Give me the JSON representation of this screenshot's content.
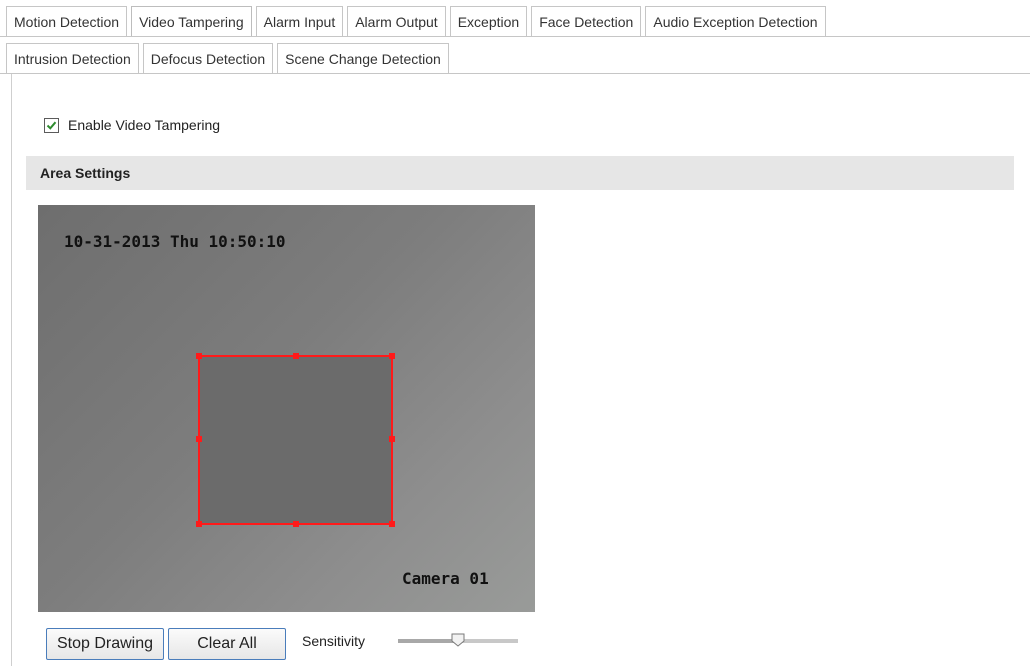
{
  "tabs": {
    "row1": [
      {
        "label": "Motion Detection",
        "active": false
      },
      {
        "label": "Video Tampering",
        "active": true
      },
      {
        "label": "Alarm Input",
        "active": false
      },
      {
        "label": "Alarm Output",
        "active": false
      },
      {
        "label": "Exception",
        "active": false
      },
      {
        "label": "Face Detection",
        "active": false
      },
      {
        "label": "Audio Exception Detection",
        "active": false
      }
    ],
    "row2": [
      {
        "label": "Intrusion Detection",
        "active": false
      },
      {
        "label": "Defocus Detection",
        "active": false
      },
      {
        "label": "Scene Change Detection",
        "active": false
      }
    ]
  },
  "enable": {
    "label": "Enable Video Tampering",
    "checked": true
  },
  "section": {
    "title": "Area Settings"
  },
  "video": {
    "timestamp": "10-31-2013 Thu 10:50:10",
    "camera_name": "Camera 01",
    "region_color": "#ff1a1a"
  },
  "controls": {
    "stop_label": "Stop Drawing",
    "clear_label": "Clear All",
    "sensitivity_label": "Sensitivity",
    "sensitivity_level": 0.5
  },
  "colors": {
    "accent_border": "#4a7dbb",
    "check": "#2e8b2e",
    "section_bg": "#e6e6e6"
  }
}
